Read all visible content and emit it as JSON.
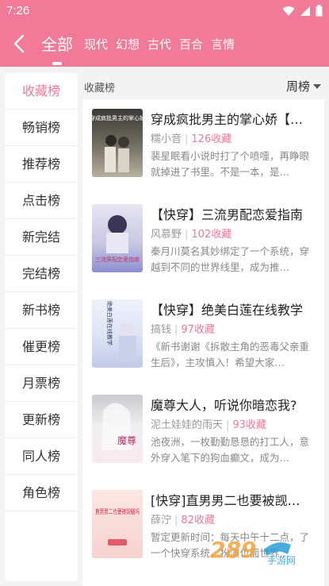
{
  "status": {
    "time": "7:26"
  },
  "nav": {
    "tabs": [
      "全部",
      "现代",
      "幻想",
      "古代",
      "百合",
      "言情"
    ],
    "active_tab": 0
  },
  "sidebar": {
    "items": [
      "收藏榜",
      "畅销榜",
      "推荐榜",
      "点击榜",
      "新完结",
      "完结榜",
      "新书榜",
      "催更榜",
      "月票榜",
      "更新榜",
      "同人榜",
      "角色榜"
    ],
    "active": 0
  },
  "list": {
    "heading": "收藏榜",
    "sort": "周榜"
  },
  "books": [
    {
      "title": "穿成疯批男主的掌心娇【…",
      "author": "糯小音",
      "favorites": "126收藏",
      "desc": "裴星眠看小说时打了个喷嚏，再睁眼就掉进了书里。不是一本，是…",
      "cover_text": "穿成疯批男主的掌心娇"
    },
    {
      "title": "【快穿】三流男配恋爱指南",
      "author": "风慕野",
      "favorites": "102收藏",
      "desc": "秦月川莫名其妙绑定了一个系统，穿越到不同的世界线里，成为推…",
      "cover_text": "三流男配恋爱指南"
    },
    {
      "title": "【快穿】绝美白莲在线教学",
      "author": "搞钱",
      "favorites": "97收藏",
      "desc": "《新书谢谢《拆散主角的恶毒父亲重生后》，主攻慎入！希望大家…",
      "cover_text": "绝美白莲在线教学"
    },
    {
      "title": "魔尊大人，听说你暗恋我?",
      "author": "泥土娃娃的雨天",
      "favorites": "93收藏",
      "desc": "池夜洲，一枚勤勤恳恳的打工人，意外穿入笔下的狗血癫文，成为…",
      "cover_text": "魔尊"
    },
    {
      "title": "[快穿]直男男二也要被觊…",
      "author": "薛泞",
      "favorites": "82收藏",
      "desc": "暂定更新时间：每天中午十二点，了一个快穿系统，扮演位面世界…",
      "cover_text": "直男男二也要被觊觎吗"
    }
  ],
  "watermark": {
    "text": "289",
    "sub": "手游网"
  },
  "colors": {
    "accent": "#f07a98"
  }
}
